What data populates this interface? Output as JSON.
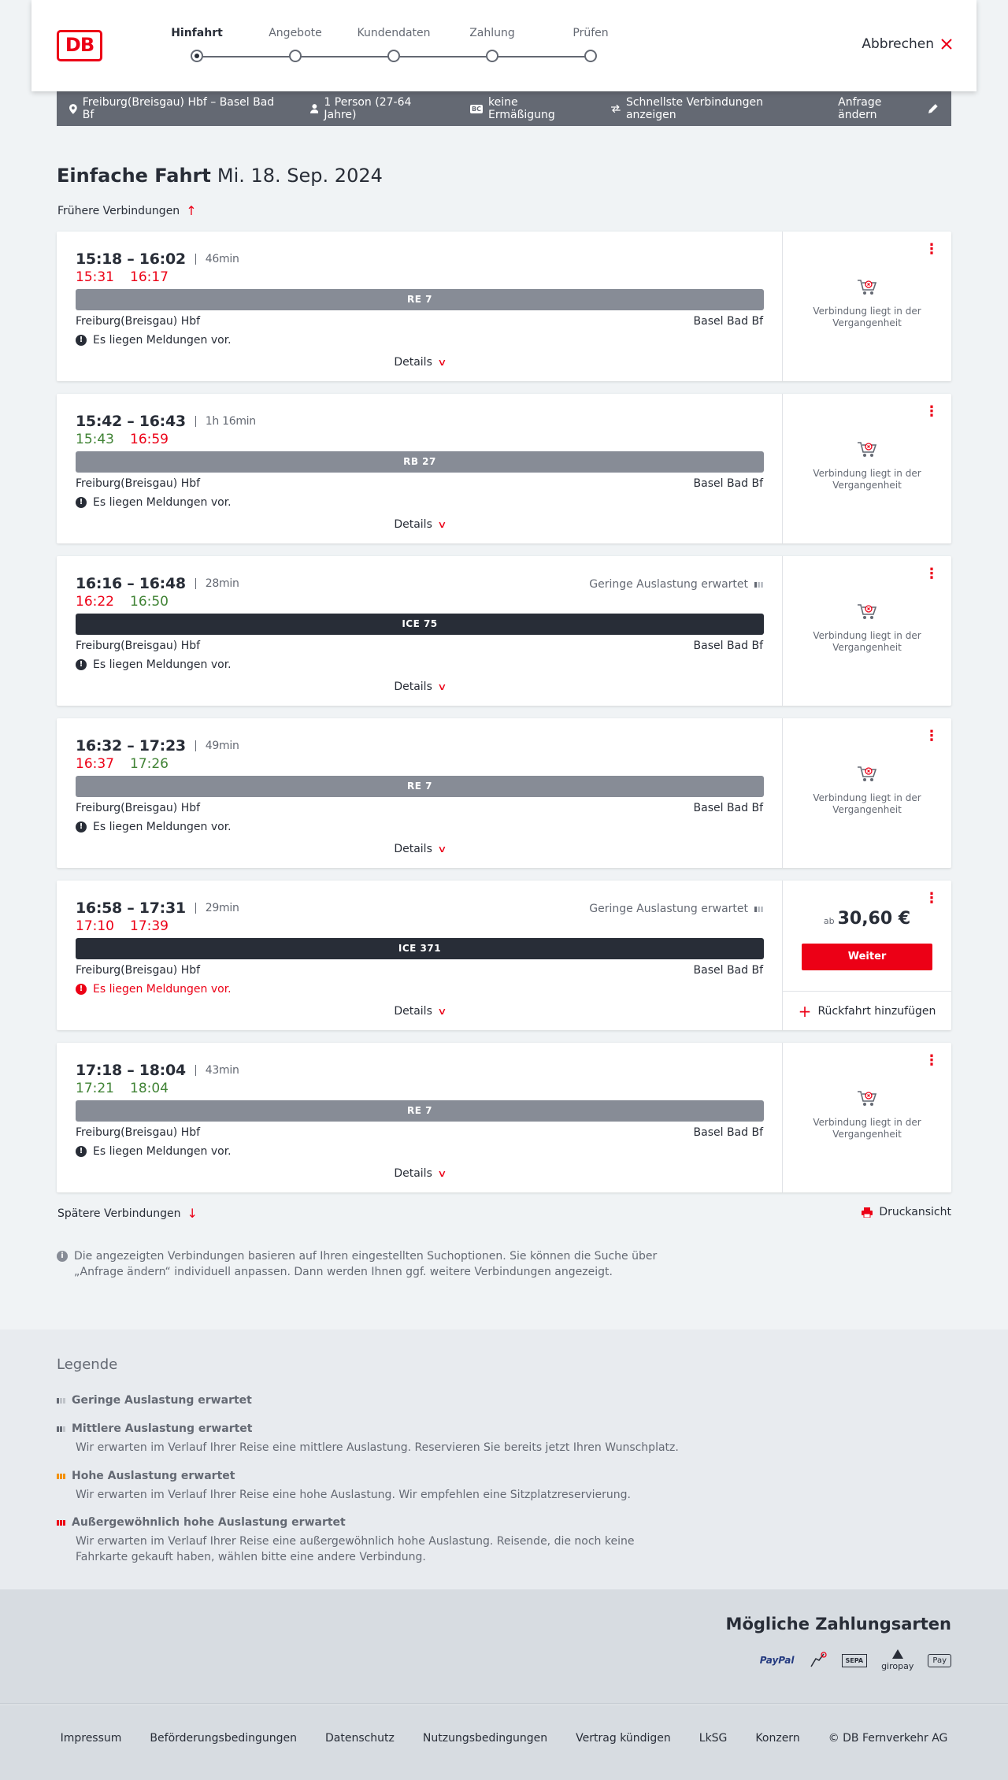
{
  "header": {
    "logo_text": "DB",
    "steps": [
      {
        "label": "Hinfahrt"
      },
      {
        "label": "Angebote"
      },
      {
        "label": "Kundendaten"
      },
      {
        "label": "Zahlung"
      },
      {
        "label": "Prüfen"
      }
    ],
    "cancel_label": "Abbrechen"
  },
  "search": {
    "route": "Freiburg(Breisgau) Hbf – Basel Bad Bf",
    "persons": "1 Person (27-64 Jahre)",
    "discount_badge": "BC",
    "discount": "keine Ermäßigung",
    "fastest": "Schnellste Verbindungen anzeigen",
    "edit_label": "Anfrage ändern"
  },
  "page": {
    "title_bold": "Einfache Fahrt",
    "title_date": "Mi. 18. Sep. 2024",
    "earlier_label": "Frühere Verbindungen",
    "later_label": "Spätere Verbindungen",
    "print_label": "Druckansicht",
    "info_text": "Die angezeigten Verbindungen basieren auf Ihren eingestellten Suchoptionen. Sie können die Suche über „Anfrage ändern“ individuell anpassen. Dann werden Ihnen ggf. weitere Verbindungen angezeigt."
  },
  "common": {
    "from": "Freiburg(Breisgau) Hbf",
    "to": "Basel Bad Bf",
    "details": "Details",
    "past_text": "Verbindung liegt in der Vergangenheit"
  },
  "connections": [
    {
      "times": "15:18 – 16:02",
      "duration": "46min",
      "rt_dep": "15:31",
      "rt_arr": "16:17",
      "train": "RE 7",
      "message": "Es liegen Meldungen vor.",
      "load": ""
    },
    {
      "times": "15:42 – 16:43",
      "duration": "1h 16min",
      "rt_dep": "15:43",
      "rt_arr": "16:59",
      "train": "RB 27",
      "message": "Es liegen Meldungen vor.",
      "load": ""
    },
    {
      "times": "16:16 – 16:48",
      "duration": "28min",
      "rt_dep": "16:22",
      "rt_arr": "16:50",
      "train": "ICE 75",
      "message": "Es liegen Meldungen vor.",
      "load": "Geringe Auslastung erwartet"
    },
    {
      "times": "16:32 – 17:23",
      "duration": "49min",
      "rt_dep": "16:37",
      "rt_arr": "17:26",
      "train": "RE 7",
      "message": "Es liegen Meldungen vor.",
      "load": ""
    },
    {
      "times": "16:58 – 17:31",
      "duration": "29min",
      "rt_dep": "17:10",
      "rt_arr": "17:39",
      "train": "ICE 371",
      "message": "Es liegen Meldungen vor.",
      "load": "Geringe Auslastung erwartet",
      "price_prefix": "ab",
      "price": "30,60 €",
      "button": "Weiter",
      "return_label": "Rückfahrt hinzufügen"
    },
    {
      "times": "17:18 – 18:04",
      "duration": "43min",
      "rt_dep": "17:21",
      "rt_arr": "18:04",
      "train": "RE 7",
      "message": "Es liegen Meldungen vor.",
      "load": ""
    }
  ],
  "legend": {
    "title": "Legende",
    "items": [
      {
        "title": "Geringe Auslastung erwartet",
        "desc": ""
      },
      {
        "title": "Mittlere Auslastung erwartet",
        "desc": "Wir erwarten im Verlauf Ihrer Reise eine mittlere Auslastung. Reservieren Sie bereits jetzt Ihren Wunschplatz."
      },
      {
        "title": "Hohe Auslastung erwartet",
        "desc": "Wir erwarten im Verlauf Ihrer Reise eine hohe Auslastung. Wir empfehlen eine Sitzplatzreservierung."
      },
      {
        "title": "Außergewöhnlich hohe Auslastung erwartet",
        "desc": "Wir erwarten im Verlauf Ihrer Reise eine außergewöhnlich hohe Auslastung. Reisende, die noch keine Fahrkarte gekauft haben, wählen bitte eine andere Verbindung."
      }
    ]
  },
  "payment": {
    "title": "Mögliche Zahlungsarten",
    "methods": [
      "PayPal",
      "SEPA",
      "giropay",
      "Pay"
    ]
  },
  "footer": {
    "links": [
      "Impressum",
      "Beförderungsbedingungen",
      "Datenschutz",
      "Nutzungsbedingungen",
      "Vertrag kündigen",
      "LkSG",
      "Konzern",
      "© DB Fernverkehr AG"
    ]
  },
  "colors": {
    "brand_red": "#ec0016",
    "on_time_green": "#408335",
    "dark": "#282d37",
    "grey_bar": "#878c96"
  }
}
